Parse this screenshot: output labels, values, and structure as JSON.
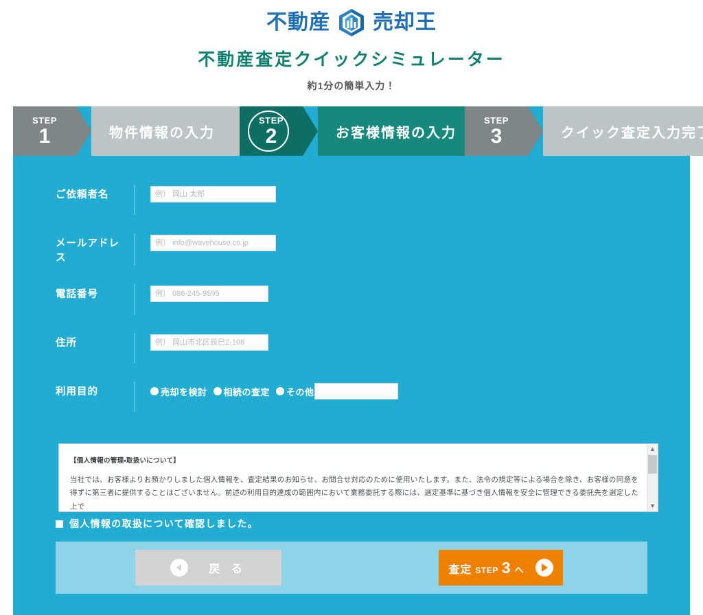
{
  "header": {
    "logo_left": "不動産",
    "logo_right": "売却王",
    "logo_icon": "hexagon-building-logo"
  },
  "page_title": "不動産査定クイックシミュレーター",
  "page_subtitle": "約1分の簡単入力！",
  "stepper": {
    "steps": [
      {
        "kicker": "STEP",
        "number": "1",
        "label": "物件情報の入力",
        "state": "inactive"
      },
      {
        "kicker": "STEP",
        "number": "2",
        "label": "お客様情報の入力",
        "state": "active"
      },
      {
        "kicker": "STEP",
        "number": "3",
        "label": "クイック査定入力完了",
        "state": "inactive"
      }
    ]
  },
  "form": {
    "name": {
      "label": "ご依頼者名",
      "placeholder": "例） 岡山 太郎",
      "value": ""
    },
    "email": {
      "label": "メールアドレス",
      "placeholder": "例） info@wavehouse.co.jp",
      "value": ""
    },
    "tel": {
      "label": "電話番号",
      "placeholder": "例） 086-245-9595",
      "value": ""
    },
    "address": {
      "label": "住所",
      "placeholder": "例） 岡山市北区辰巳2-108",
      "value": ""
    },
    "purpose": {
      "label": "利用目的",
      "options": [
        {
          "text": "売却を検討",
          "selected": false
        },
        {
          "text": "相続の査定",
          "selected": false
        },
        {
          "text": "その他",
          "selected": false
        }
      ],
      "other_value": "",
      "other_placeholder": ""
    }
  },
  "privacy": {
    "heading": "【個人情報の管理・取扱いについて】",
    "body": "当社では、お客様よりお預かりしました個人情報を、査定結果のお知らせ、お問合せ対応のために使用いたします。また、法令の規定等による場合を除き、お客様の同意を得ずに第三者に提供することはございません。前述の利用目的達成の範囲内において業務委託する際には、選定基準に基づき個人情報を安全に管理できる委託先を選定した上で",
    "scroll_up_icon": "chevron-up-icon",
    "scroll_down_icon": "chevron-down-icon"
  },
  "consent": {
    "label": "個人情報の取扱について確認しました。",
    "checked": false
  },
  "actions": {
    "back": {
      "label": "戻 る",
      "icon": "circle-arrow-left-icon"
    },
    "next": {
      "label_main": "査定",
      "label_step": "STEP",
      "label_number": "3",
      "label_suffix": "へ",
      "icon": "circle-play-right-icon"
    }
  },
  "colors": {
    "background_blue": "#22acd2",
    "active_teal": "#17897c",
    "active_teal_dark": "#0d6e63",
    "inactive_gray": "#bcc5c5",
    "inactive_gray_dark": "#7f8687",
    "title_green": "#11806f",
    "accent_orange": "#f08100",
    "panel_light_blue": "#8ed4e8"
  }
}
